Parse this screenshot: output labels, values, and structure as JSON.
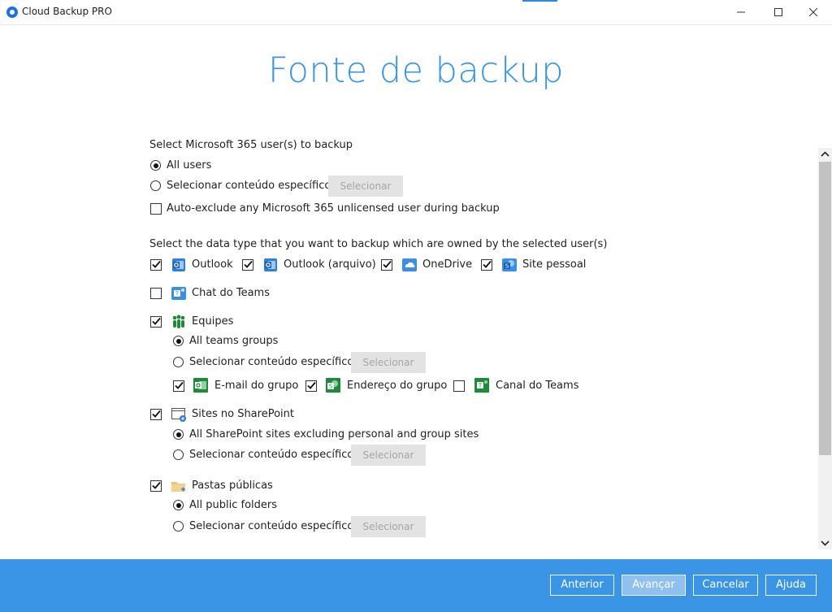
{
  "window": {
    "title": "Cloud Backup PRO",
    "minimize": "—",
    "maximize": "☐",
    "close": "✕"
  },
  "page_title": "Fonte de backup",
  "users": {
    "heading": "Select Microsoft 365 user(s) to backup",
    "all_users": "All users",
    "specific": "Selecionar conteúdo específico",
    "select_btn": "Selecionar",
    "auto_exclude": "Auto-exclude any Microsoft 365 unlicensed user during backup",
    "selected": "all_users",
    "auto_exclude_checked": false
  },
  "datatype": {
    "heading": "Select the data type that you want to backup which are owned by the selected user(s)",
    "outlook": "Outlook",
    "outlook_archive": "Outlook (arquivo)",
    "onedrive": "OneDrive",
    "site_pessoal": "Site pessoal",
    "chat_teams": "Chat do Teams"
  },
  "teams": {
    "label": "Equipes",
    "all": "All teams groups",
    "specific": "Selecionar conteúdo específico",
    "select_btn": "Selecionar",
    "group_mail": "E-mail do grupo",
    "group_site": "Endereço do grupo",
    "channel": "Canal do Teams"
  },
  "sharepoint": {
    "label": "Sites no SharePoint",
    "all": "All SharePoint sites excluding personal and group sites",
    "specific": "Selecionar conteúdo específico",
    "select_btn": "Selecionar"
  },
  "public_folders": {
    "label": "Pastas públicas",
    "all": "All public folders",
    "specific": "Selecionar conteúdo específico",
    "select_btn": "Selecionar"
  },
  "footer": {
    "previous": "Anterior",
    "next": "Avançar",
    "cancel": "Cancelar",
    "help": "Ajuda"
  },
  "colors": {
    "accent": "#3b95e6",
    "outlook_blue": "#2f7fd8",
    "teams_green": "#1f8a3a"
  }
}
